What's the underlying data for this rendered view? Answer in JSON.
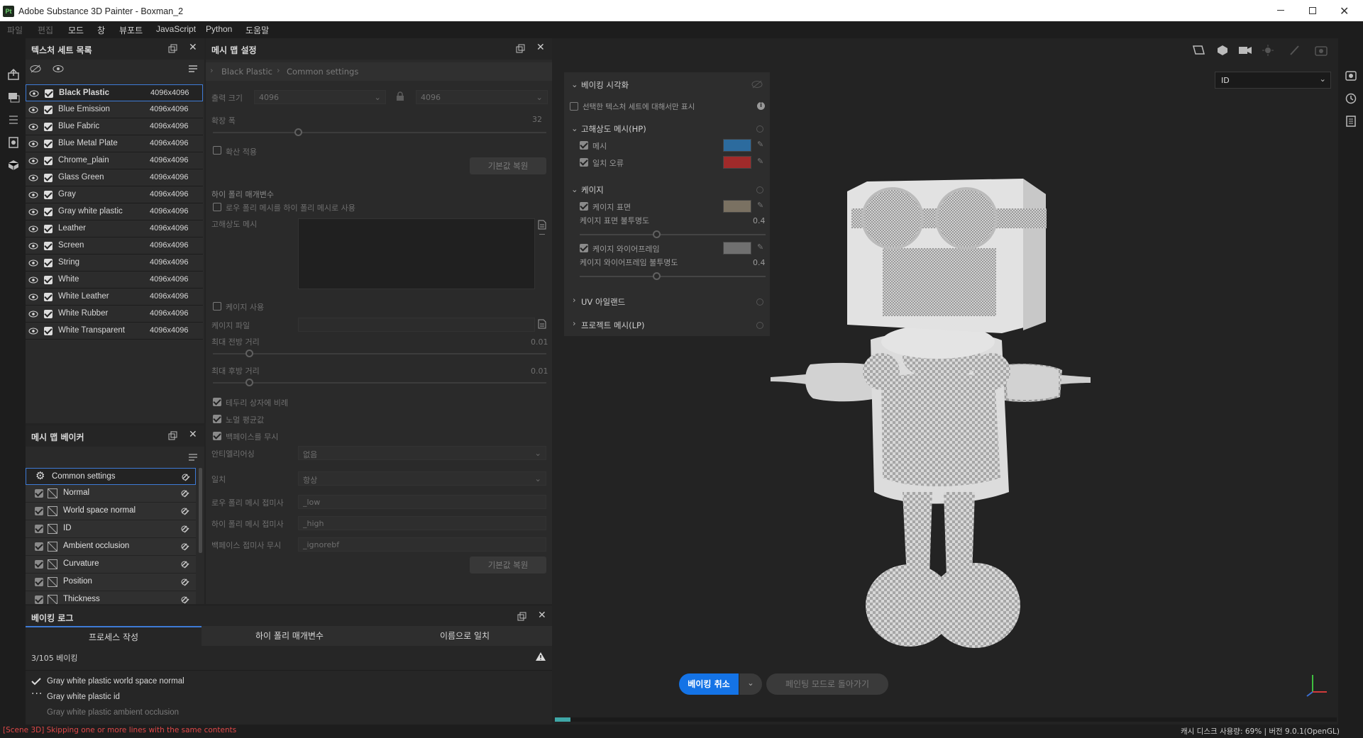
{
  "window": {
    "app_icon": "Pt",
    "title": "Adobe Substance 3D Painter - Boxman_2"
  },
  "menu": [
    "파일",
    "편집",
    "모드",
    "창",
    "뷰포트",
    "JavaScript",
    "Python",
    "도움말"
  ],
  "texture_sets": {
    "title": "텍스처 세트 목록",
    "items": [
      {
        "name": "Black Plastic",
        "size": "4096x4096"
      },
      {
        "name": "Blue Emission",
        "size": "4096x4096"
      },
      {
        "name": "Blue Fabric",
        "size": "4096x4096"
      },
      {
        "name": "Blue Metal Plate",
        "size": "4096x4096"
      },
      {
        "name": "Chrome_plain",
        "size": "4096x4096"
      },
      {
        "name": "Glass Green",
        "size": "4096x4096"
      },
      {
        "name": "Gray",
        "size": "4096x4096"
      },
      {
        "name": "Gray white plastic",
        "size": "4096x4096"
      },
      {
        "name": "Leather",
        "size": "4096x4096"
      },
      {
        "name": "Screen",
        "size": "4096x4096"
      },
      {
        "name": "String",
        "size": "4096x4096"
      },
      {
        "name": "White",
        "size": "4096x4096"
      },
      {
        "name": "White Leather",
        "size": "4096x4096"
      },
      {
        "name": "White Rubber",
        "size": "4096x4096"
      },
      {
        "name": "White Transparent",
        "size": "4096x4096"
      }
    ]
  },
  "bakers": {
    "title": "메시 맵 베이커",
    "common": "Common settings",
    "items": [
      "Normal",
      "World space normal",
      "ID",
      "Ambient occlusion",
      "Curvature",
      "Position",
      "Thickness"
    ]
  },
  "mesh_settings": {
    "title": "메시 맵 설정",
    "breadcrumb": [
      "Black Plastic",
      "Common settings"
    ],
    "output_size_label": "출력 크기",
    "output_size_a": "4096",
    "output_size_b": "4096",
    "dilation_label": "확장 폭",
    "dilation_value": "32",
    "apply_diffusion": "확산 적용",
    "reset_label": "기본값 복원",
    "hipoly_params": "하이 폴리 매개변수",
    "use_low_as_high": "로우 폴리 메시를 하이 폴리 메시로 사용",
    "hires_mesh": "고해상도 메시",
    "use_cage": "케이지 사용",
    "cage_file": "케이지 파일",
    "max_front": "최대 전방 거리",
    "max_front_val": "0.01",
    "max_rear": "최대 후방 거리",
    "max_rear_val": "0.01",
    "relative_bbox": "테두리 상자에 비례",
    "average_normals": "노멀 평균값",
    "ignore_backface": "백페이스를 무시",
    "antialias_label": "안티엘리어싱",
    "antialias_value": "없음",
    "match_label": "일치",
    "match_value": "항상",
    "low_suffix_label": "로우 폴리 메시 접미사",
    "low_suffix": "_low",
    "high_suffix_label": "하이 폴리 메시 접미사",
    "high_suffix": "_high",
    "ignore_suffix_label": "백페이스 접미사 무시",
    "ignore_suffix": "_ignorebf",
    "reset_label2": "기본값 복원"
  },
  "bake_vis": {
    "title": "베이킹 시각화",
    "only_selected": "선택한 텍스처 세트에 대해서만 표시",
    "hp_title": "고해상도 메시(HP)",
    "mesh": "메시",
    "mismatch": "일치 오류",
    "cage_title": "케이지",
    "cage_surface": "케이지 표면",
    "cage_surface_opacity": "케이지 표면 불투명도",
    "cage_surface_opacity_val": "0.4",
    "cage_wire": "케이지 와이어프레임",
    "cage_wire_opacity": "케이지 와이어프레임 불투명도",
    "cage_wire_opacity_val": "0.4",
    "uv_islands": "UV 아일랜드",
    "projected_mesh": "프로젝트 메시(LP)",
    "colors": {
      "mesh": "#2c6b9e",
      "mismatch": "#a02a2a",
      "cage_surface": "#7a7162",
      "cage_wire": "#707070"
    }
  },
  "viewport": {
    "display_mode": "ID",
    "cancel_bake": "베이킹 취소",
    "return_paint": "페인팅 모드로 돌아가기"
  },
  "bake_log": {
    "title": "베이킹 로그",
    "tabs": [
      "프로세스 작성",
      "하이 폴리 매개변수",
      "이름으로 일치"
    ],
    "progress": "3/105 베이킹",
    "lines": [
      "Gray white plastic world space normal",
      "Gray white plastic id",
      "Gray white plastic ambient occlusion"
    ]
  },
  "status": {
    "error": "[Scene 3D] Skipping one or more lines with the same contents",
    "info": "캐시 디스크 사용량:   69% | 버전 9.0.1(OpenGL)"
  }
}
